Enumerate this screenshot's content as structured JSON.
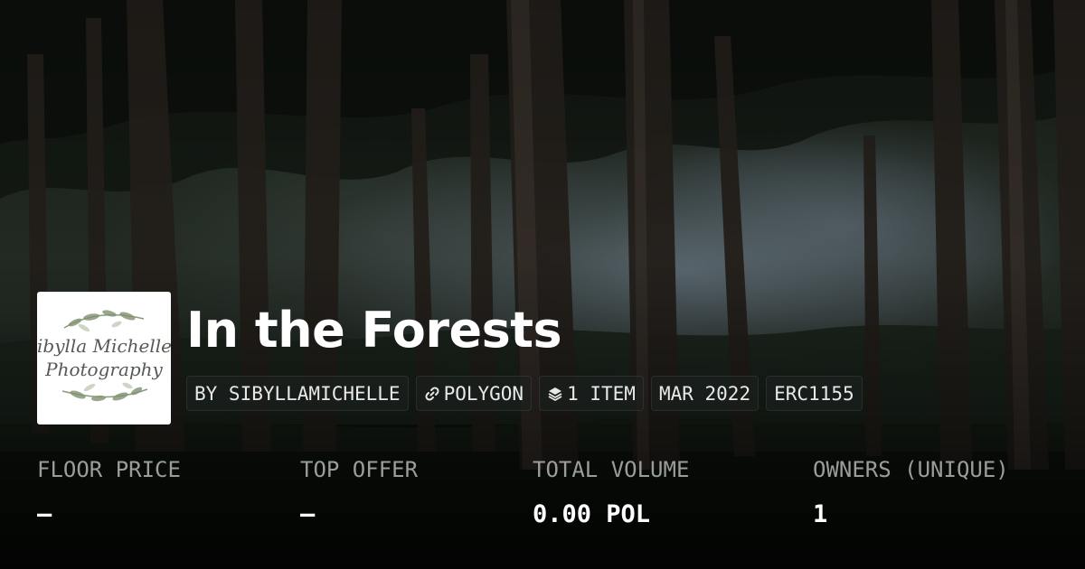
{
  "collection": {
    "title": "In the Forests",
    "avatar": {
      "line1": "ibylla Michelle",
      "line2": "Photography"
    }
  },
  "tags": [
    {
      "label": "BY SIBYLLAMICHELLE",
      "icon": null
    },
    {
      "label": "POLYGON",
      "icon": "chain-link-icon"
    },
    {
      "label": "1 ITEM",
      "icon": "layers-icon"
    },
    {
      "label": "MAR 2022",
      "icon": null
    },
    {
      "label": "ERC1155",
      "icon": null
    }
  ],
  "stats": [
    {
      "label": "FLOOR PRICE",
      "value": "–"
    },
    {
      "label": "TOP OFFER",
      "value": "–"
    },
    {
      "label": "TOTAL VOLUME",
      "value": "0.00 POL"
    },
    {
      "label": "OWNERS (UNIQUE)",
      "value": "1"
    }
  ]
}
